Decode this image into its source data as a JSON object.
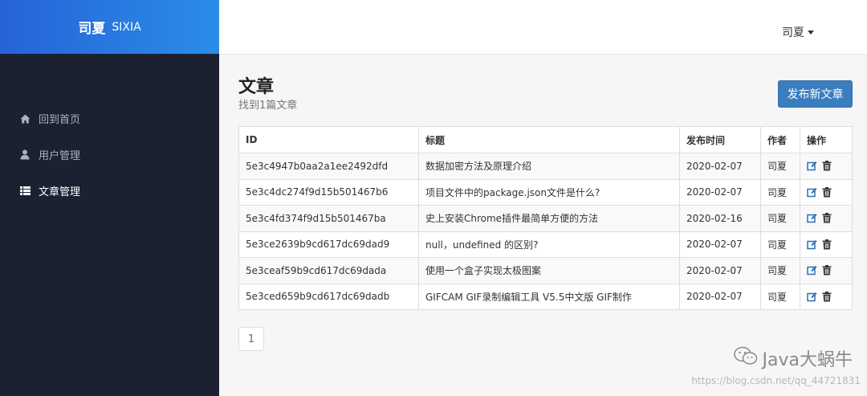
{
  "brand": {
    "name_cn": "司夏",
    "name_en": "SIXIA"
  },
  "sidebar": {
    "items": [
      {
        "label": "回到首页",
        "icon": "home-icon",
        "active": false
      },
      {
        "label": "用户管理",
        "icon": "user-icon",
        "active": false
      },
      {
        "label": "文章管理",
        "icon": "list-icon",
        "active": true
      }
    ]
  },
  "header": {
    "user": "司夏"
  },
  "page": {
    "title": "文章",
    "subtitle": "找到1篇文章",
    "new_button": "发布新文章"
  },
  "table": {
    "headers": {
      "id": "ID",
      "title": "标题",
      "date": "发布时间",
      "author": "作者",
      "ops": "操作"
    },
    "rows": [
      {
        "id": "5e3c4947b0aa2a1ee2492dfd",
        "title": "数据加密方法及原理介绍",
        "date": "2020-02-07",
        "author": "司夏"
      },
      {
        "id": "5e3c4dc274f9d15b501467b6",
        "title": "项目文件中的package.json文件是什么?",
        "date": "2020-02-07",
        "author": "司夏"
      },
      {
        "id": "5e3c4fd374f9d15b501467ba",
        "title": "史上安装Chrome插件最简单方便的方法",
        "date": "2020-02-16",
        "author": "司夏"
      },
      {
        "id": "5e3ce2639b9cd617dc69dad9",
        "title": "null，undefined 的区别?",
        "date": "2020-02-07",
        "author": "司夏"
      },
      {
        "id": "5e3ceaf59b9cd617dc69dada",
        "title": "使用一个盒子实现太极图案",
        "date": "2020-02-07",
        "author": "司夏"
      },
      {
        "id": "5e3ced659b9cd617dc69dadb",
        "title": "GIFCAM GIF录制编辑工具 V5.5中文版 GIF制作",
        "date": "2020-02-07",
        "author": "司夏"
      }
    ],
    "row_icons": [
      "edit-icon",
      "trash-icon"
    ]
  },
  "pagination": {
    "current": "1"
  },
  "watermark": {
    "text": "Java大蜗牛",
    "url": "https://blog.csdn.net/qq_44721831"
  },
  "colors": {
    "accent": "#3b7ebf",
    "sidebar_bg": "#1b2131",
    "icon_blue": "#2c6fb8"
  }
}
